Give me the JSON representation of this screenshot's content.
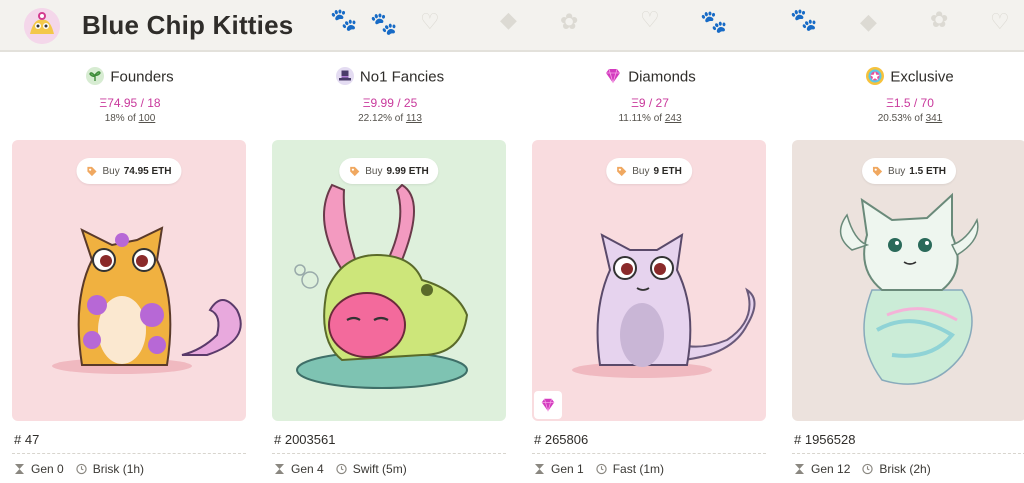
{
  "header": {
    "title": "Blue Chip Kitties"
  },
  "columns": [
    {
      "category": "Founders",
      "price": "Ξ74.95 / 18",
      "share": "18% of",
      "total": "100",
      "buy_label": "Buy",
      "buy_price": "74.95 ETH",
      "kitty_id": "# 47",
      "generation": "Gen 0",
      "speed": "Brisk (1h)",
      "card_bg": "#f9dcdf",
      "accent": "#c9399c"
    },
    {
      "category": "No1 Fancies",
      "price": "Ξ9.99 / 25",
      "share": "22.12% of",
      "total": "113",
      "buy_label": "Buy",
      "buy_price": "9.99 ETH",
      "kitty_id": "# 2003561",
      "generation": "Gen 4",
      "speed": "Swift (5m)",
      "card_bg": "#def0dc",
      "accent": "#c9399c"
    },
    {
      "category": "Diamonds",
      "price": "Ξ9 / 27",
      "share": "11.11% of",
      "total": "243",
      "buy_label": "Buy",
      "buy_price": "9 ETH",
      "kitty_id": "# 265806",
      "generation": "Gen 1",
      "speed": "Fast (1m)",
      "card_bg": "#f9dcdf",
      "accent": "#c9399c"
    },
    {
      "category": "Exclusive",
      "price": "Ξ1.5 / 70",
      "share": "20.53% of",
      "total": "341",
      "buy_label": "Buy",
      "buy_price": "1.5 ETH",
      "kitty_id": "# 1956528",
      "generation": "Gen 12",
      "speed": "Brisk (2h)",
      "card_bg": "#ece2dd",
      "accent": "#c9399c"
    }
  ]
}
